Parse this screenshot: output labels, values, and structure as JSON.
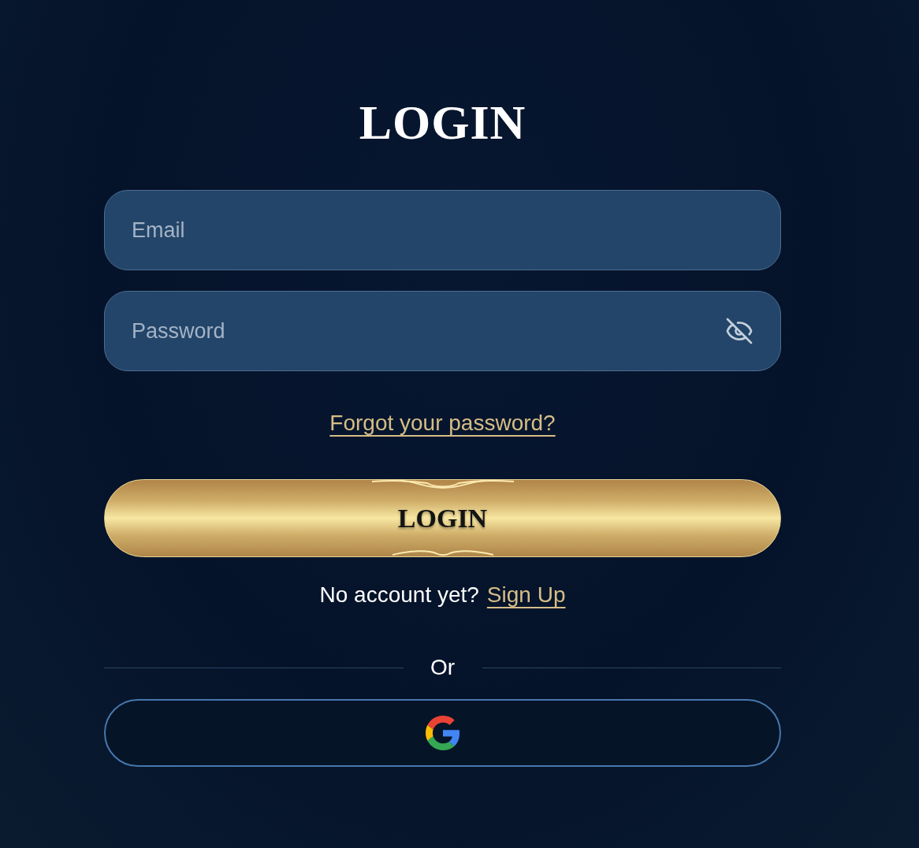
{
  "title": "LOGIN",
  "fields": [
    {
      "kind": "text",
      "placeholder": "Email"
    },
    {
      "kind": "password",
      "placeholder": "Password"
    }
  ],
  "forgot_link": "Forgot your password?",
  "login_button": "LOGIN",
  "signup": {
    "prompt": "No account yet?",
    "link": "Sign Up"
  },
  "divider": "Or"
}
